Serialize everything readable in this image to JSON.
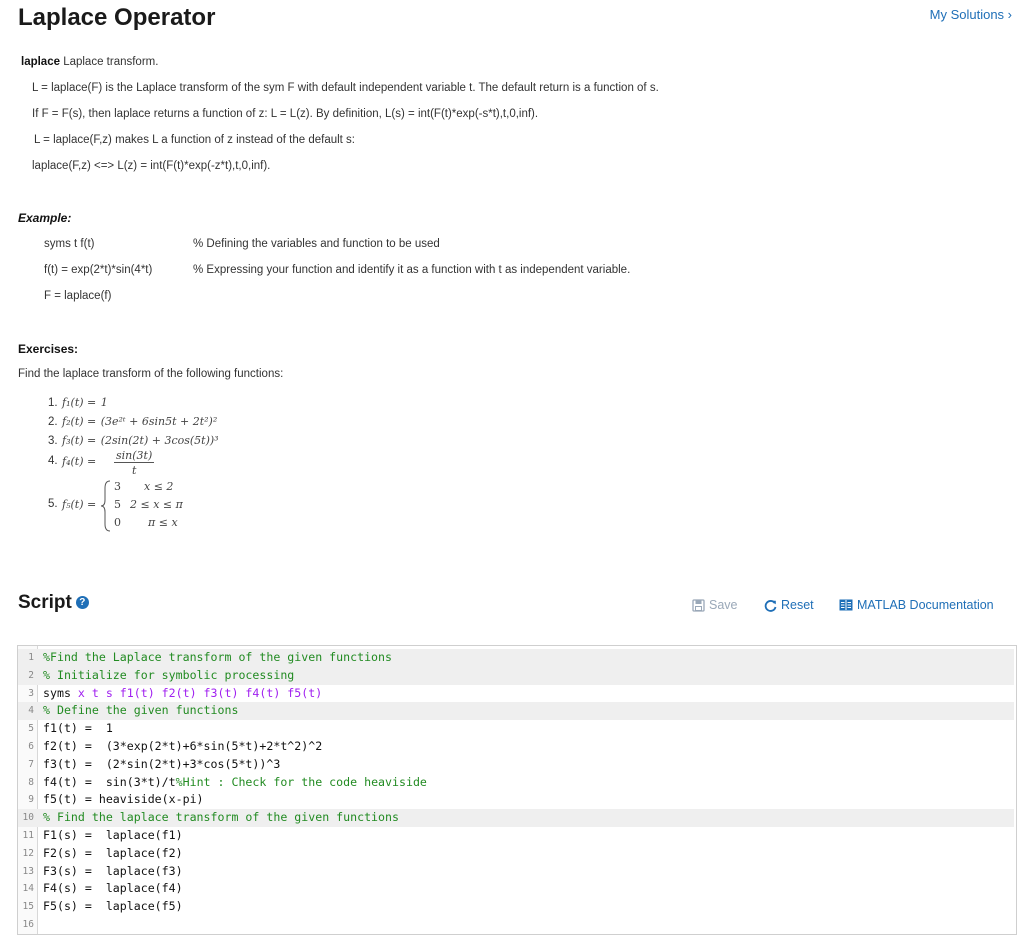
{
  "page_title": "Laplace Operator",
  "my_solutions": "My Solutions ›",
  "description": {
    "line1_bold": "laplace",
    "line1_rest": " Laplace transform.",
    "line2": "L = laplace(F) is the Laplace transform of the sym F with default independent variable t.  The default return is a function of s.",
    "line3": "If F = F(s), then laplace returns a function of z:  L = L(z).    By definition, L(s) = int(F(t)*exp(-s*t),t,0,inf).",
    "line4": "L = laplace(F,z) makes L a function of z instead of the default s:",
    "line5": "laplace(F,z) <=> L(z) = int(F(t)*exp(-z*t),t,0,inf)."
  },
  "example": {
    "heading": "Example:",
    "rows": [
      {
        "code": "syms t f(t)",
        "comment": "% Defining the variables and function to be used"
      },
      {
        "code": "f(t) = exp(2*t)*sin(4*t)",
        "comment": "% Expressing your function and identify it as a function with t as independent variable."
      },
      {
        "code": "F = laplace(f)",
        "comment": ""
      }
    ]
  },
  "exercises": {
    "heading": "Exercises:",
    "intro": "Find the laplace transform of the following functions:",
    "items": [
      {
        "num": "1.",
        "lhs": "f₁(t) =",
        "rhs": "1"
      },
      {
        "num": "2.",
        "lhs": "f₂(t) =",
        "rhs": "(3e²ᵗ + 6sin5t + 2t²)²"
      },
      {
        "num": "3.",
        "lhs": "f₃(t) =",
        "rhs": "(2sin(2t) + 3cos(5t))³"
      },
      {
        "num": "4.",
        "lhs": "f₄(t) =",
        "numerator": "sin(3t)",
        "denominator": "t"
      },
      {
        "num": "5.",
        "lhs": "f₅(t) =",
        "cases": [
          {
            "val": "3",
            "cond": "x ≤ 2"
          },
          {
            "val": "5",
            "cond": "2 ≤ x ≤ π"
          },
          {
            "val": "0",
            "cond": "π ≤ x"
          }
        ]
      }
    ]
  },
  "script": {
    "heading": "Script",
    "save_label": "Save",
    "reset_label": "Reset",
    "doc_label": "MATLAB Documentation",
    "lines": [
      {
        "n": "1",
        "hl": true
      },
      {
        "n": "2",
        "hl": true
      },
      {
        "n": "3",
        "hl": false
      },
      {
        "n": "4",
        "hl": true
      },
      {
        "n": "5",
        "hl": false
      },
      {
        "n": "6",
        "hl": false
      },
      {
        "n": "7",
        "hl": false
      },
      {
        "n": "8",
        "hl": false
      },
      {
        "n": "9",
        "hl": false
      },
      {
        "n": "10",
        "hl": true
      },
      {
        "n": "11",
        "hl": false
      },
      {
        "n": "12",
        "hl": false
      },
      {
        "n": "13",
        "hl": false
      },
      {
        "n": "14",
        "hl": false
      },
      {
        "n": "15",
        "hl": false
      },
      {
        "n": "16",
        "hl": false
      }
    ],
    "code": {
      "l1": "%Find the Laplace transform of the given functions",
      "l2": "% Initialize for symbolic processing",
      "l3a": "syms ",
      "l3b": "x t s f1(t) f2(t) f3(t) f4(t) f5(t)",
      "l4": "% Define the given functions",
      "l5": "f1(t) =  1",
      "l6": "f2(t) =  (3*exp(2*t)+6*sin(5*t)+2*t^2)^2",
      "l7": "f3(t) =  (2*sin(2*t)+3*cos(5*t))^3",
      "l8a": "f4(t) =  sin(3*t)/t",
      "l8b": "%Hint : Check for the code heaviside",
      "l9": "f5(t) = heaviside(x-pi)",
      "l10": "% Find the laplace transform of the given functions",
      "l11": "F1(s) =  laplace(f1)",
      "l12": "F2(s) =  laplace(f2)",
      "l13": "F3(s) =  laplace(f3)",
      "l14": "F4(s) =  laplace(f4)",
      "l15": "F5(s) =  laplace(f5)",
      "l16": ""
    }
  },
  "colors": {
    "link": "#1f6fb7",
    "comment": "#228b22",
    "keyword_args": "#a020f0"
  }
}
